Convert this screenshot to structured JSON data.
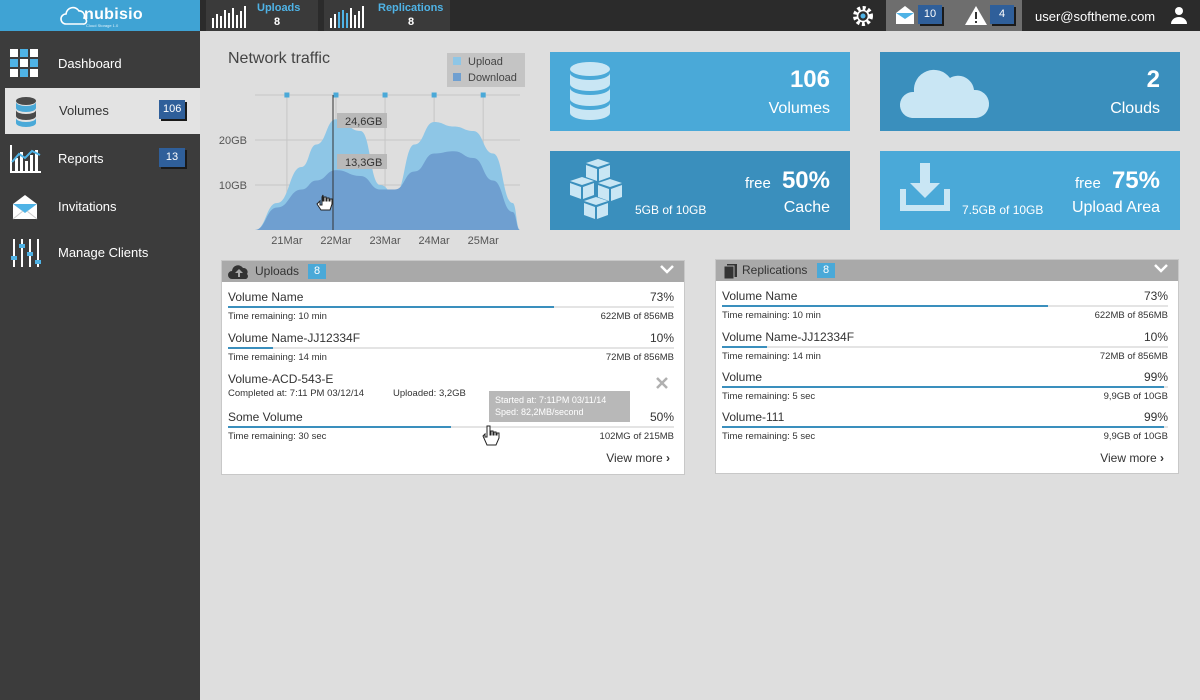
{
  "app": {
    "brand": "nubisio",
    "tagline": "Cloud Storage 1.0",
    "user_email": "user@softheme.com"
  },
  "topbar": {
    "uploads": {
      "label": "Uploads",
      "count": "8"
    },
    "replications": {
      "label": "Replications",
      "count": "8"
    },
    "messages_count": "10",
    "alerts_count": "4",
    "icons": {
      "settings": "gear-icon",
      "messages": "envelope-icon",
      "alerts": "warning-icon",
      "user": "user-icon"
    }
  },
  "sidebar": {
    "items": [
      {
        "label": "Dashboard",
        "icon": "grid-icon",
        "badge": null
      },
      {
        "label": "Volumes",
        "icon": "database-icon",
        "badge": "106"
      },
      {
        "label": "Reports",
        "icon": "bar-chart-icon",
        "badge": "13"
      },
      {
        "label": "Invitations",
        "icon": "envelope-open-icon",
        "badge": null
      },
      {
        "label": "Manage Clients",
        "icon": "sliders-icon",
        "badge": null
      }
    ]
  },
  "network": {
    "title": "Network traffic",
    "legend": {
      "upload": "Upload",
      "download": "Download"
    },
    "callouts": {
      "upload_value": "24,6GB",
      "download_value": "13,3GB"
    },
    "colors": {
      "upload": "#8ec6e6",
      "download": "#6f9fd0"
    }
  },
  "chart_data": {
    "type": "area",
    "title": "Network traffic",
    "categories": [
      "21Mar",
      "22Mar",
      "23Mar",
      "24Mar",
      "25Mar"
    ],
    "y_ticks": [
      "10GB",
      "20GB"
    ],
    "ylim": [
      0,
      30
    ],
    "series": [
      {
        "name": "Upload",
        "x": [
          20.35,
          20.8,
          21.3,
          21.6,
          22.0,
          22.5,
          22.9,
          23.2,
          23.6,
          24.0,
          24.4,
          24.8,
          25.2,
          25.6,
          25.75
        ],
        "values": [
          0,
          6,
          14,
          19,
          24.6,
          22,
          10,
          8,
          19,
          24,
          23,
          22,
          17,
          6,
          0
        ]
      },
      {
        "name": "Download",
        "x": [
          20.35,
          20.8,
          21.3,
          21.6,
          22.0,
          22.5,
          22.9,
          23.2,
          23.6,
          24.0,
          24.4,
          24.8,
          25.2,
          25.6,
          25.75
        ],
        "values": [
          0,
          5,
          9,
          11,
          13.3,
          12,
          9,
          9,
          13,
          17,
          17.5,
          16,
          11,
          4,
          0
        ]
      }
    ],
    "legend_position": "top-right",
    "grid": true
  },
  "tiles": [
    {
      "value": "106",
      "label": "Volumes",
      "icon": "database-icon"
    },
    {
      "value": "2",
      "label": "Clouds",
      "icon": "cloud-icon"
    },
    {
      "free": "free",
      "value": "50%",
      "label": "Cache",
      "detail": "5GB of 10GB",
      "icon": "cubes-icon"
    },
    {
      "free": "free",
      "value": "75%",
      "label": "Upload Area",
      "detail": "7.5GB of 10GB",
      "icon": "download-icon"
    }
  ],
  "uploads_panel": {
    "title": "Uploads",
    "count": "8",
    "view_more": "View more",
    "rows": [
      {
        "name": "Volume Name",
        "pct": "73%",
        "progress": 0.73,
        "time": "Time remaining: 10 min",
        "size": "622MB of 856MB"
      },
      {
        "name": "Volume Name-JJ12334F",
        "pct": "10%",
        "progress": 0.1,
        "time": "Time remaining: 14 min",
        "size": "72MB of 856MB"
      },
      {
        "name": "Volume-ACD-543-E",
        "completed": "Completed at: 7:11 PM 03/12/14",
        "uploaded": "Uploaded: 3,2GB"
      },
      {
        "name": "Some Volume",
        "pct": "50%",
        "progress": 0.5,
        "time": "Time remaining: 30 sec",
        "size": "102MG of 215MB"
      }
    ],
    "tooltip": {
      "line1": "Started at: 7:11PM 03/11/14",
      "line2": "Sped: 82,2MB/second"
    }
  },
  "replications_panel": {
    "title": "Replications",
    "count": "8",
    "view_more": "View more",
    "rows": [
      {
        "name": "Volume Name",
        "pct": "73%",
        "progress": 0.73,
        "time": "Time remaining: 10 min",
        "size": "622MB of 856MB"
      },
      {
        "name": "Volume Name-JJ12334F",
        "pct": "10%",
        "progress": 0.1,
        "time": "Time remaining: 14 min",
        "size": "72MB of 856MB"
      },
      {
        "name": "Volume",
        "pct": "99%",
        "progress": 0.99,
        "time": "Time remaining: 5 sec",
        "size": "9,9GB of 10GB"
      },
      {
        "name": "Volume-111",
        "pct": "99%",
        "progress": 0.99,
        "time": "Time remaining: 5 sec",
        "size": "9,9GB of 10GB"
      }
    ]
  }
}
